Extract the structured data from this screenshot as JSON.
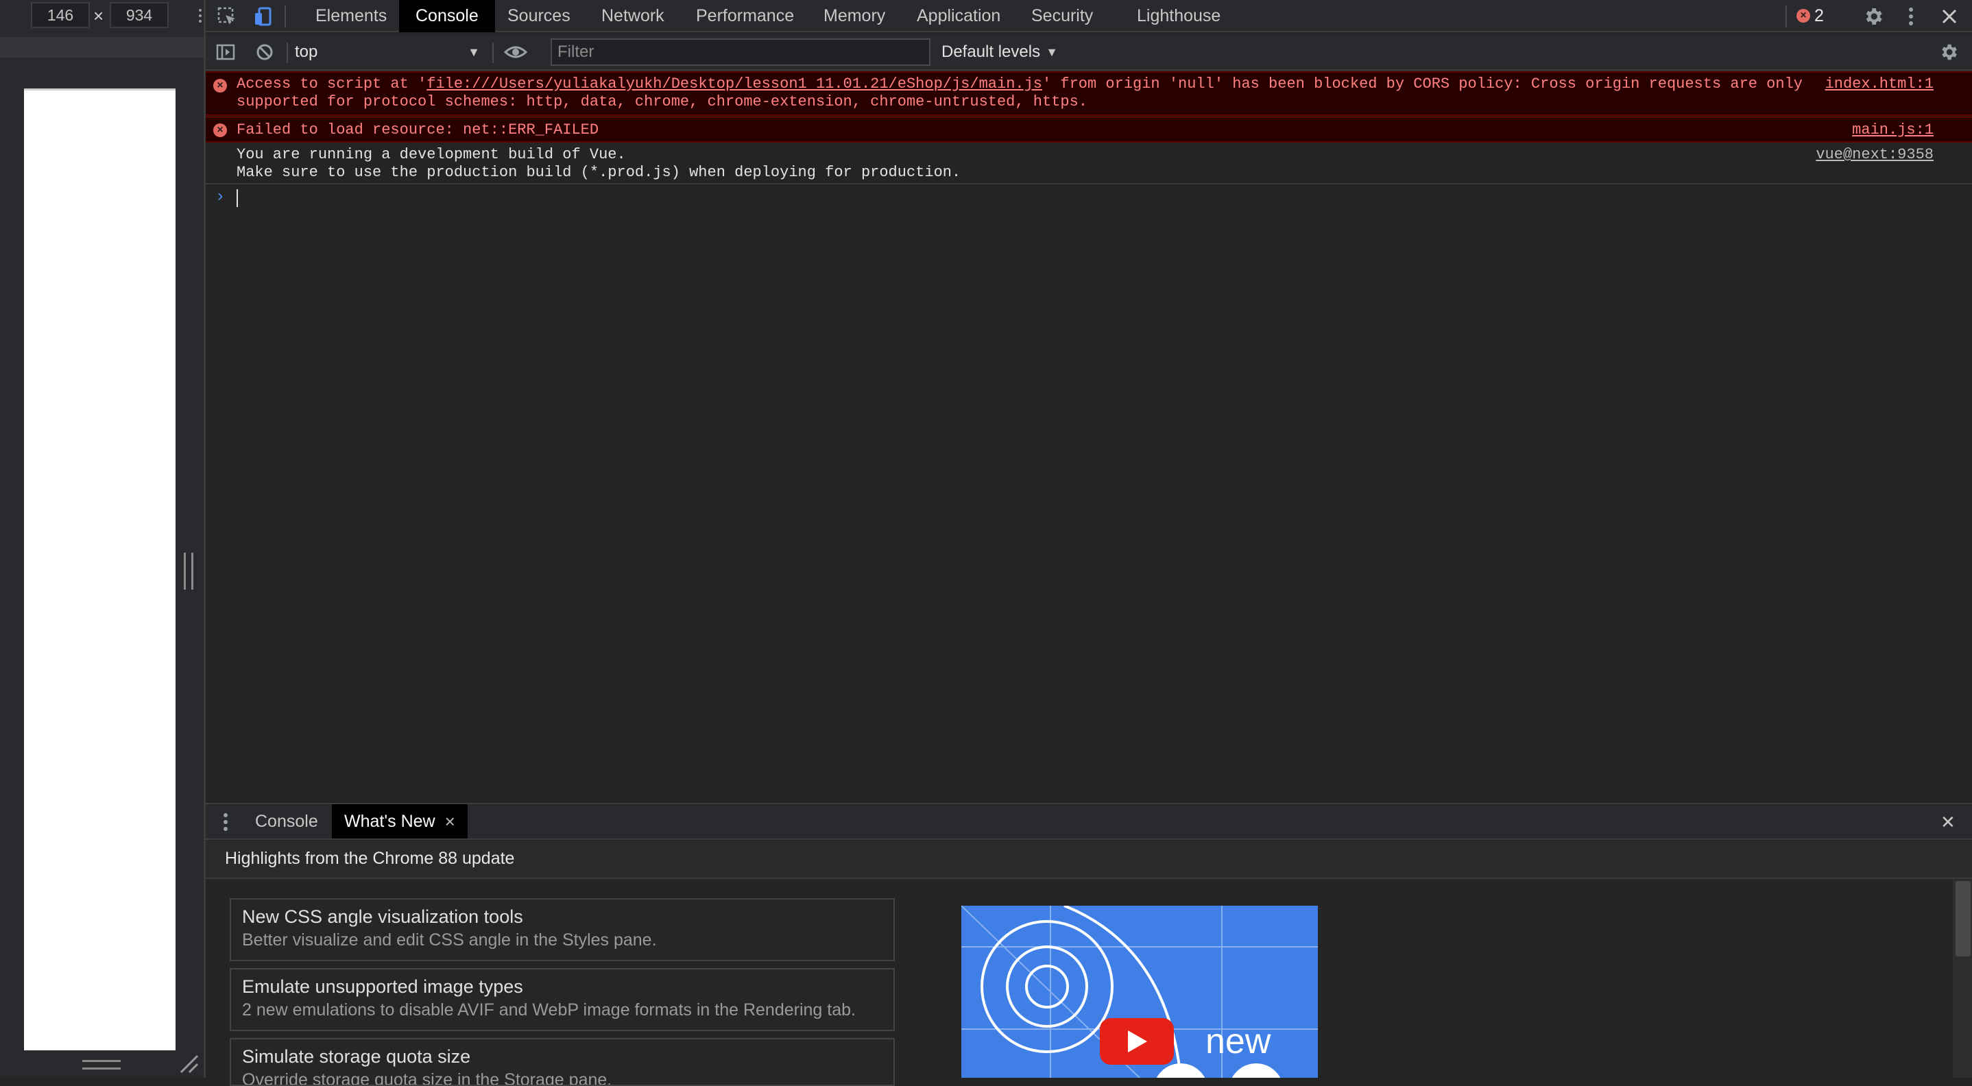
{
  "device": {
    "width": "146",
    "height": "934",
    "separator": "×"
  },
  "toolbar": {
    "tabs": [
      "Elements",
      "Console",
      "Sources",
      "Network",
      "Performance",
      "Memory",
      "Application",
      "Security",
      "Lighthouse"
    ],
    "active_tab": "Console",
    "error_count": "2",
    "error_badge_icon": "error-x-icon"
  },
  "console_toolbar": {
    "context": "top",
    "filter_placeholder": "Filter",
    "filter_value": "",
    "levels": "Default levels"
  },
  "messages": [
    {
      "level": "error",
      "prefix": "Access to script at '",
      "url": "file:///Users/yuliakalyukh/Desktop/lesson1 11.01.21/eShop/js/main.js",
      "suffix": "' from origin 'null' has been blocked by CORS policy: Cross origin requests are only",
      "line2": "supported for protocol schemes: http, data, chrome, chrome-extension, chrome-untrusted, https.",
      "source": "index.html:1"
    },
    {
      "level": "error",
      "text": "Failed to load resource: net::ERR_FAILED",
      "source": "main.js:1"
    },
    {
      "level": "log",
      "line1": "You are running a development build of Vue.",
      "line2": "Make sure to use the production build (*.prod.js) when deploying for production.",
      "source": "vue@next:9358"
    }
  ],
  "drawer": {
    "tabs": [
      {
        "label": "Console",
        "closable": false
      },
      {
        "label": "What's New",
        "closable": true
      }
    ],
    "active_tab": "What's New",
    "close_tab_glyph": "×",
    "close_drawer_glyph": "✕",
    "highlights_title": "Highlights from the Chrome 88 update",
    "features": [
      {
        "title": "New CSS angle visualization tools",
        "desc": "Better visualize and edit CSS angle in the Styles pane."
      },
      {
        "title": "Emulate unsupported image types",
        "desc": "2 new emulations to disable AVIF and WebP image formats in the Rendering tab."
      },
      {
        "title": "Simulate storage quota size",
        "desc": "Override storage quota size in the Storage pane."
      }
    ],
    "video_badge_text": "new"
  },
  "colors": {
    "error_bg": "#290000",
    "error_text": "#ff8080",
    "accent_blue": "#4f8bf3",
    "youtube_red": "#e62117",
    "video_blue": "#3f7fe6"
  }
}
